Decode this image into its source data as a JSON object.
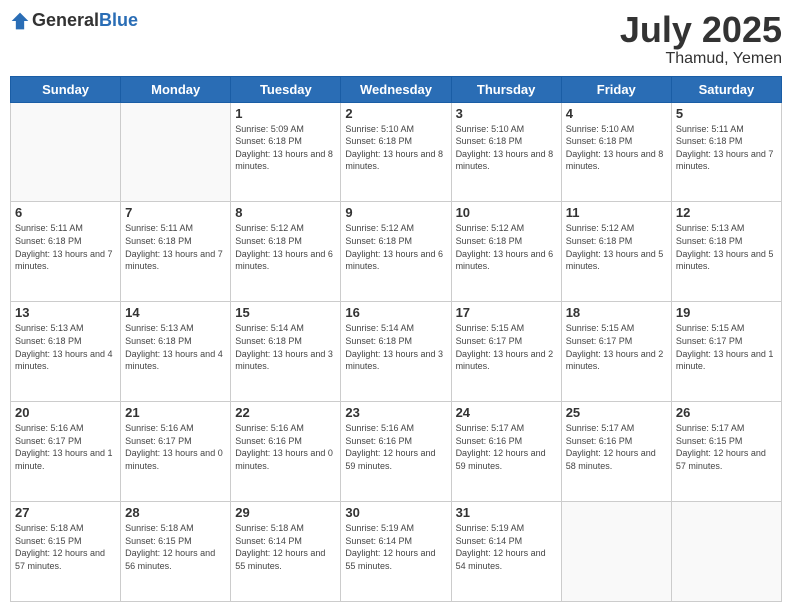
{
  "header": {
    "logo_general": "General",
    "logo_blue": "Blue",
    "title": "July 2025",
    "location": "Thamud, Yemen"
  },
  "days_of_week": [
    "Sunday",
    "Monday",
    "Tuesday",
    "Wednesday",
    "Thursday",
    "Friday",
    "Saturday"
  ],
  "weeks": [
    [
      {
        "day": "",
        "info": ""
      },
      {
        "day": "",
        "info": ""
      },
      {
        "day": "1",
        "info": "Sunrise: 5:09 AM\nSunset: 6:18 PM\nDaylight: 13 hours and 8 minutes."
      },
      {
        "day": "2",
        "info": "Sunrise: 5:10 AM\nSunset: 6:18 PM\nDaylight: 13 hours and 8 minutes."
      },
      {
        "day": "3",
        "info": "Sunrise: 5:10 AM\nSunset: 6:18 PM\nDaylight: 13 hours and 8 minutes."
      },
      {
        "day": "4",
        "info": "Sunrise: 5:10 AM\nSunset: 6:18 PM\nDaylight: 13 hours and 8 minutes."
      },
      {
        "day": "5",
        "info": "Sunrise: 5:11 AM\nSunset: 6:18 PM\nDaylight: 13 hours and 7 minutes."
      }
    ],
    [
      {
        "day": "6",
        "info": "Sunrise: 5:11 AM\nSunset: 6:18 PM\nDaylight: 13 hours and 7 minutes."
      },
      {
        "day": "7",
        "info": "Sunrise: 5:11 AM\nSunset: 6:18 PM\nDaylight: 13 hours and 7 minutes."
      },
      {
        "day": "8",
        "info": "Sunrise: 5:12 AM\nSunset: 6:18 PM\nDaylight: 13 hours and 6 minutes."
      },
      {
        "day": "9",
        "info": "Sunrise: 5:12 AM\nSunset: 6:18 PM\nDaylight: 13 hours and 6 minutes."
      },
      {
        "day": "10",
        "info": "Sunrise: 5:12 AM\nSunset: 6:18 PM\nDaylight: 13 hours and 6 minutes."
      },
      {
        "day": "11",
        "info": "Sunrise: 5:12 AM\nSunset: 6:18 PM\nDaylight: 13 hours and 5 minutes."
      },
      {
        "day": "12",
        "info": "Sunrise: 5:13 AM\nSunset: 6:18 PM\nDaylight: 13 hours and 5 minutes."
      }
    ],
    [
      {
        "day": "13",
        "info": "Sunrise: 5:13 AM\nSunset: 6:18 PM\nDaylight: 13 hours and 4 minutes."
      },
      {
        "day": "14",
        "info": "Sunrise: 5:13 AM\nSunset: 6:18 PM\nDaylight: 13 hours and 4 minutes."
      },
      {
        "day": "15",
        "info": "Sunrise: 5:14 AM\nSunset: 6:18 PM\nDaylight: 13 hours and 3 minutes."
      },
      {
        "day": "16",
        "info": "Sunrise: 5:14 AM\nSunset: 6:18 PM\nDaylight: 13 hours and 3 minutes."
      },
      {
        "day": "17",
        "info": "Sunrise: 5:15 AM\nSunset: 6:17 PM\nDaylight: 13 hours and 2 minutes."
      },
      {
        "day": "18",
        "info": "Sunrise: 5:15 AM\nSunset: 6:17 PM\nDaylight: 13 hours and 2 minutes."
      },
      {
        "day": "19",
        "info": "Sunrise: 5:15 AM\nSunset: 6:17 PM\nDaylight: 13 hours and 1 minute."
      }
    ],
    [
      {
        "day": "20",
        "info": "Sunrise: 5:16 AM\nSunset: 6:17 PM\nDaylight: 13 hours and 1 minute."
      },
      {
        "day": "21",
        "info": "Sunrise: 5:16 AM\nSunset: 6:17 PM\nDaylight: 13 hours and 0 minutes."
      },
      {
        "day": "22",
        "info": "Sunrise: 5:16 AM\nSunset: 6:16 PM\nDaylight: 13 hours and 0 minutes."
      },
      {
        "day": "23",
        "info": "Sunrise: 5:16 AM\nSunset: 6:16 PM\nDaylight: 12 hours and 59 minutes."
      },
      {
        "day": "24",
        "info": "Sunrise: 5:17 AM\nSunset: 6:16 PM\nDaylight: 12 hours and 59 minutes."
      },
      {
        "day": "25",
        "info": "Sunrise: 5:17 AM\nSunset: 6:16 PM\nDaylight: 12 hours and 58 minutes."
      },
      {
        "day": "26",
        "info": "Sunrise: 5:17 AM\nSunset: 6:15 PM\nDaylight: 12 hours and 57 minutes."
      }
    ],
    [
      {
        "day": "27",
        "info": "Sunrise: 5:18 AM\nSunset: 6:15 PM\nDaylight: 12 hours and 57 minutes."
      },
      {
        "day": "28",
        "info": "Sunrise: 5:18 AM\nSunset: 6:15 PM\nDaylight: 12 hours and 56 minutes."
      },
      {
        "day": "29",
        "info": "Sunrise: 5:18 AM\nSunset: 6:14 PM\nDaylight: 12 hours and 55 minutes."
      },
      {
        "day": "30",
        "info": "Sunrise: 5:19 AM\nSunset: 6:14 PM\nDaylight: 12 hours and 55 minutes."
      },
      {
        "day": "31",
        "info": "Sunrise: 5:19 AM\nSunset: 6:14 PM\nDaylight: 12 hours and 54 minutes."
      },
      {
        "day": "",
        "info": ""
      },
      {
        "day": "",
        "info": ""
      }
    ]
  ]
}
